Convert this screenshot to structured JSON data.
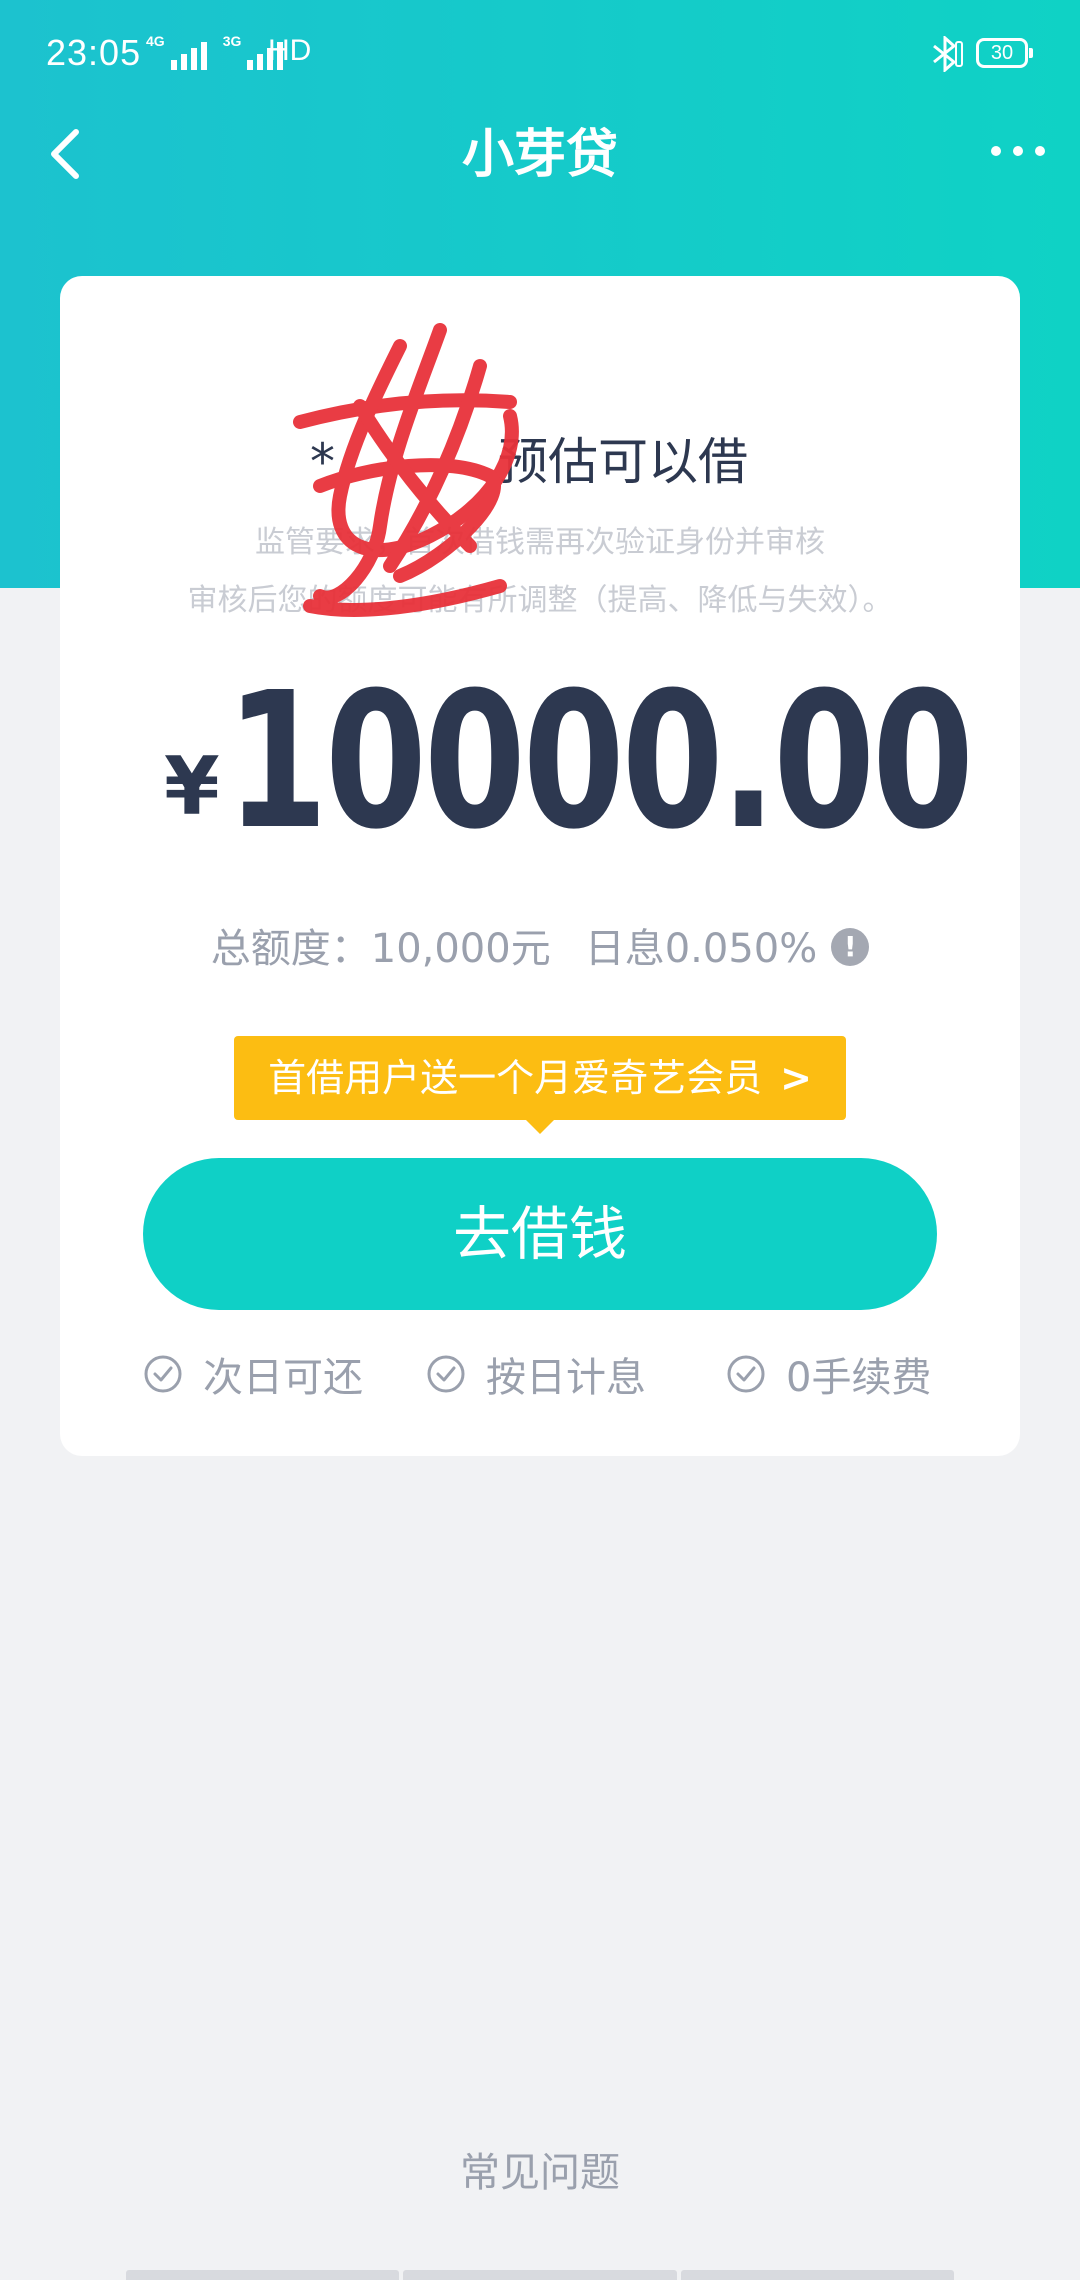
{
  "status_bar": {
    "time": "23:05",
    "network_1": "4G",
    "network_2": "3G",
    "hd": "HD",
    "battery": "30"
  },
  "nav": {
    "title": "小芽贷"
  },
  "card": {
    "masked_name": "*",
    "estimate_label": "预估可以借",
    "notice_line_1": "监管要求，首次借钱需再次验证身份并审核",
    "notice_line_2": "审核后您的额度可能有所调整（提高、降低与失效）。",
    "currency_symbol": "¥",
    "amount": "10000.00",
    "total_quota": "总额度：10,000元",
    "daily_interest": "日息0.050%",
    "promo_text": "首借用户送一个月爱奇艺会员",
    "borrow_button": "去借钱",
    "features": [
      "次日可还",
      "按日计息",
      "0手续费"
    ]
  },
  "footer": {
    "faq": "常见问题"
  },
  "colors": {
    "header_start": "#1cc2cf",
    "header_end": "#0fd2c5",
    "primary_button": "#0fd0c6",
    "promo": "#fcbd12",
    "text_dark": "#2d3850",
    "text_muted": "#9aa0ad",
    "redaction": "#e8323a"
  },
  "icons": {
    "back": "chevron-left-icon",
    "more": "more-dots-icon",
    "info": "exclamation-circle-icon",
    "check": "check-circle-icon",
    "promo_arrow": "chevron-right-icon"
  }
}
